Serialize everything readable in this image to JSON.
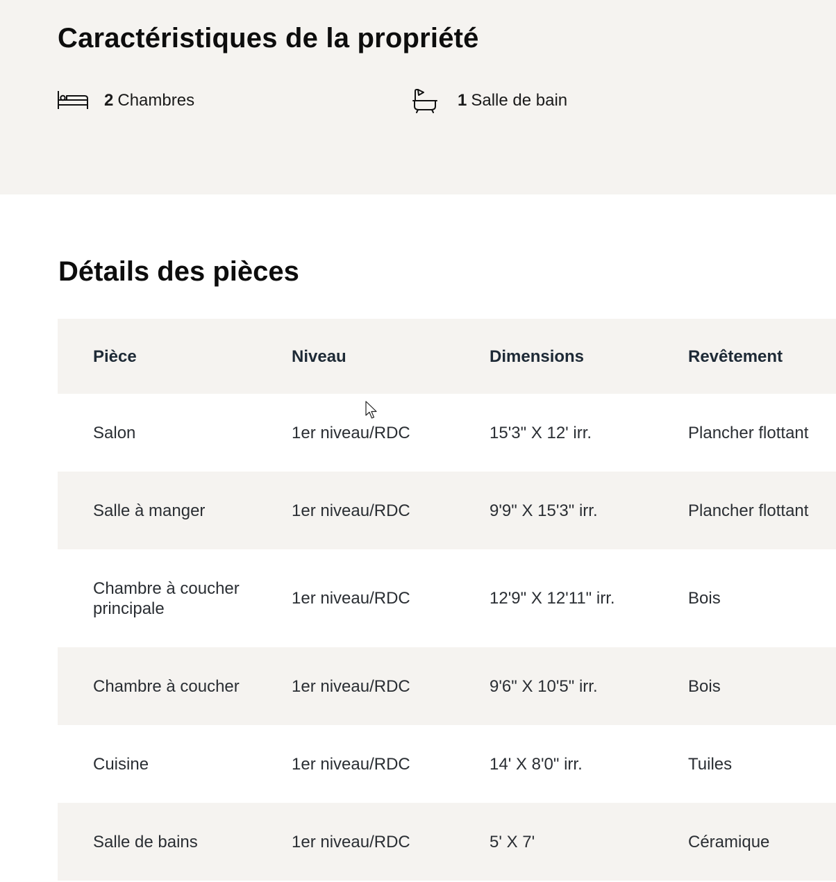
{
  "features": {
    "title": "Caractéristiques de la propriété",
    "bedrooms": {
      "count": "2",
      "label": "Chambres",
      "icon": "bed-icon"
    },
    "bathrooms": {
      "count": "1",
      "label": "Salle de bain",
      "icon": "bathtub-icon"
    }
  },
  "rooms": {
    "title": "Détails des pièces",
    "columns": [
      "Pièce",
      "Niveau",
      "Dimensions",
      "Revêtement"
    ],
    "rows": [
      [
        "Salon",
        "1er niveau/RDC",
        "15'3\" X 12' irr.",
        "Plancher flottant"
      ],
      [
        "Salle à manger",
        "1er niveau/RDC",
        "9'9\" X 15'3\" irr.",
        "Plancher flottant"
      ],
      [
        "Chambre à coucher principale",
        "1er niveau/RDC",
        "12'9\" X 12'11\" irr.",
        "Bois"
      ],
      [
        "Chambre à coucher",
        "1er niveau/RDC",
        "9'6\" X 10'5\" irr.",
        "Bois"
      ],
      [
        "Cuisine",
        "1er niveau/RDC",
        "14' X 8'0\" irr.",
        "Tuiles"
      ],
      [
        "Salle de bains",
        "1er niveau/RDC",
        "5' X 7'",
        "Céramique"
      ]
    ]
  },
  "colors": {
    "section_background": "#f5f3f0",
    "text": "#111111",
    "table_text": "#2a2e33"
  }
}
